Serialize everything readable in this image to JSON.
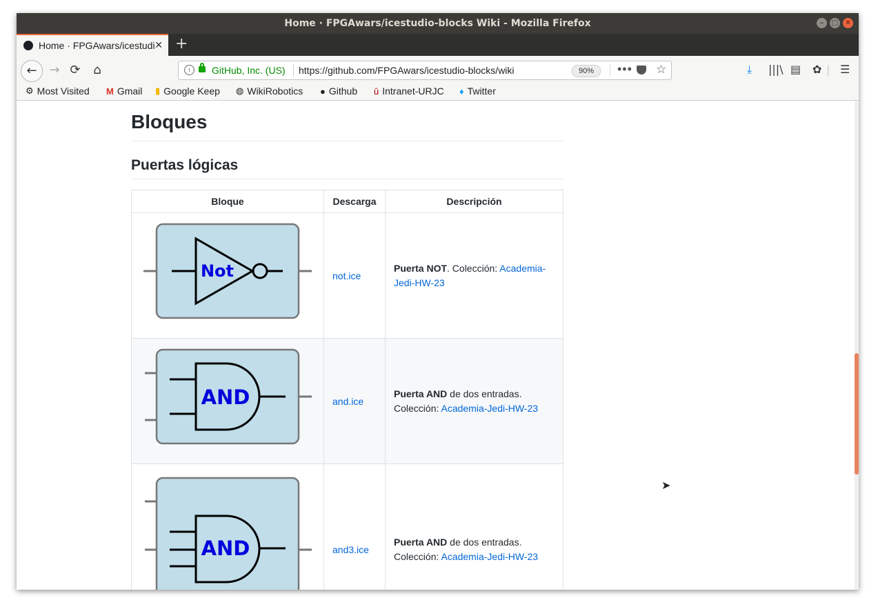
{
  "window": {
    "title": "Home · FPGAwars/icestudio-blocks Wiki - Mozilla Firefox",
    "controls": [
      "minimize",
      "maximize",
      "close"
    ]
  },
  "tabs": [
    {
      "title": "Home · FPGAwars/icestudio-blocks Wiki",
      "close": "✕",
      "favicon": "github-icon"
    }
  ],
  "new_tab": "+",
  "navbar": {
    "back": "←",
    "forward": "→",
    "reload": "⟳",
    "home": "⌂",
    "site_owner": "GitHub, Inc. (US)",
    "url": "https://github.com/FPGAwars/icestudio-blocks/wiki",
    "zoom": "90%",
    "more": "•••",
    "toolbar_icons": [
      "download-icon",
      "library-icon",
      "sidebar-icon",
      "gnome-icon",
      "menu-icon"
    ]
  },
  "bookmarks": [
    {
      "label": "Most Visited",
      "icon": "gear-icon"
    },
    {
      "label": "Gmail",
      "icon": "gmail-icon"
    },
    {
      "label": "Google Keep",
      "icon": "keep-icon"
    },
    {
      "label": "WikiRobotics",
      "icon": "globe-icon"
    },
    {
      "label": "Github",
      "icon": "github-icon"
    },
    {
      "label": "Intranet-URJC",
      "icon": "urjc-icon"
    },
    {
      "label": "Twitter",
      "icon": "twitter-icon"
    }
  ],
  "page": {
    "heading": "Bloques",
    "subheading": "Puertas lógicas",
    "table": {
      "headers": [
        "Bloque",
        "Descarga",
        "Descripción"
      ],
      "rows": [
        {
          "gate_label": "Not",
          "download": "not.ice",
          "desc_bold": "Puerta NOT",
          "desc_text": ". Colección: ",
          "desc_link": "Academia-Jedi-HW-23"
        },
        {
          "gate_label": "AND",
          "download": "and.ice",
          "desc_bold": "Puerta AND",
          "desc_text": " de dos entradas. Colección: ",
          "desc_link": "Academia-Jedi-HW-23"
        },
        {
          "gate_label": "AND",
          "download": "and3.ice",
          "desc_bold": "Puerta AND",
          "desc_text": " de dos entradas. Colección: ",
          "desc_link": "Academia-Jedi-HW-23"
        }
      ]
    }
  },
  "colors": {
    "accent": "#e9643b",
    "link": "#0366d6",
    "secure_green": "#058b00",
    "block_fill": "#c0dde9",
    "gate_label": "#0000dd"
  }
}
